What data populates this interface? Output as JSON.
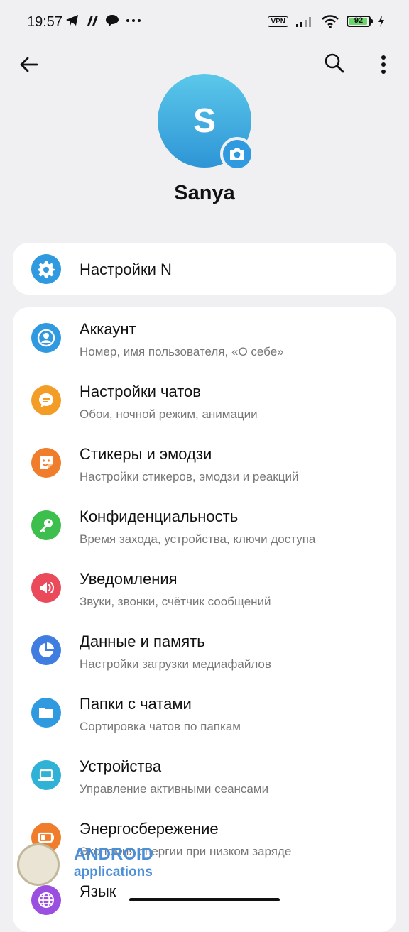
{
  "status_bar": {
    "time": "19:57",
    "left_icons": [
      "telegram-icon",
      "app-icon",
      "messenger-icon",
      "more-dots"
    ],
    "vpn_label": "VPN",
    "battery_level": "92"
  },
  "top_bar": {
    "back_icon": "arrow-left-icon",
    "search_icon": "search-icon",
    "menu_icon": "more-vertical-icon"
  },
  "profile": {
    "initial": "S",
    "name": "Sanya",
    "avatar_color": "#3aa9e0"
  },
  "card1": {
    "items": [
      {
        "title": "Настройки N",
        "icon": "gear-icon",
        "color": "#2f9ae0"
      }
    ]
  },
  "settings": {
    "items": [
      {
        "title": "Аккаунт",
        "subtitle": "Номер, имя пользователя, «О себе»",
        "icon": "account-icon",
        "color": "#2f9ae0"
      },
      {
        "title": "Настройки чатов",
        "subtitle": "Обои, ночной режим, анимации",
        "icon": "chat-settings-icon",
        "color": "#f39c26"
      },
      {
        "title": "Стикеры и эмодзи",
        "subtitle": "Настройки стикеров, эмодзи и реакций",
        "icon": "sticker-icon",
        "color": "#f07d2c"
      },
      {
        "title": "Конфиденциальность",
        "subtitle": "Время захода, устройства, ключи доступа",
        "icon": "key-icon",
        "color": "#3cbf4d"
      },
      {
        "title": "Уведомления",
        "subtitle": "Звуки, звонки, счётчик сообщений",
        "icon": "speaker-icon",
        "color": "#ea4a5a"
      },
      {
        "title": "Данные и память",
        "subtitle": "Настройки загрузки медиафайлов",
        "icon": "pie-chart-icon",
        "color": "#3f7ee0"
      },
      {
        "title": "Папки с чатами",
        "subtitle": "Сортировка чатов по папкам",
        "icon": "folder-icon",
        "color": "#2f9ae0"
      },
      {
        "title": "Устройства",
        "subtitle": "Управление активными сеансами",
        "icon": "laptop-icon",
        "color": "#2fb2d6"
      },
      {
        "title": "Энергосбережение",
        "subtitle": "Экономия энергии при низком заряде",
        "icon": "battery-icon",
        "color": "#f07d2c"
      },
      {
        "title": "Язык",
        "subtitle": "",
        "icon": "globe-icon",
        "color": "#9b4fe0"
      }
    ]
  },
  "watermark": {
    "line1": "ANDROID",
    "line2": "applications"
  }
}
